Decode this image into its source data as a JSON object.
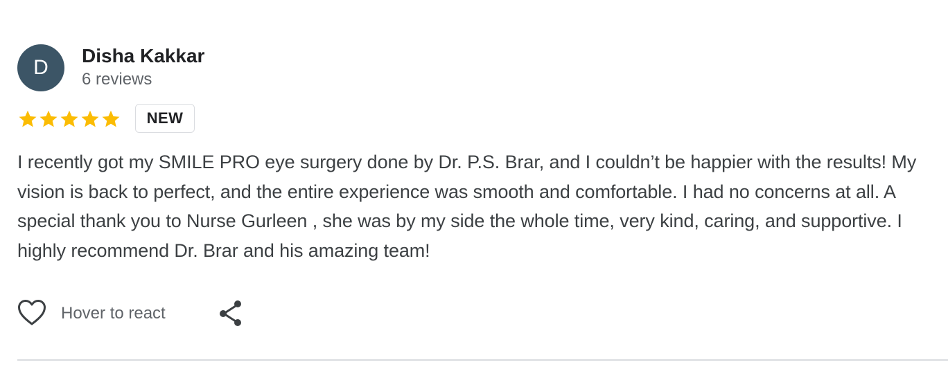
{
  "reviewer": {
    "initial": "D",
    "name": "Disha Kakkar",
    "review_count": "6 reviews",
    "avatar_color": "#3c5566"
  },
  "rating": {
    "stars": 5,
    "max_stars": 5,
    "star_color": "#fbbc04",
    "badge": "NEW"
  },
  "review": {
    "text": "I recently got my SMILE PRO eye surgery done by Dr. P.S. Brar, and I couldn’t be happier with the results! My vision is back to perfect, and the entire experience was smooth and comfortable. I had no concerns at all. A special thank you to Nurse Gurleen , she was by my side the whole time, very kind, caring, and supportive. I highly recommend Dr. Brar and his amazing team!"
  },
  "actions": {
    "react_label": "Hover to react",
    "react_icon": "heart-outline-icon",
    "share_icon": "share-icon"
  }
}
